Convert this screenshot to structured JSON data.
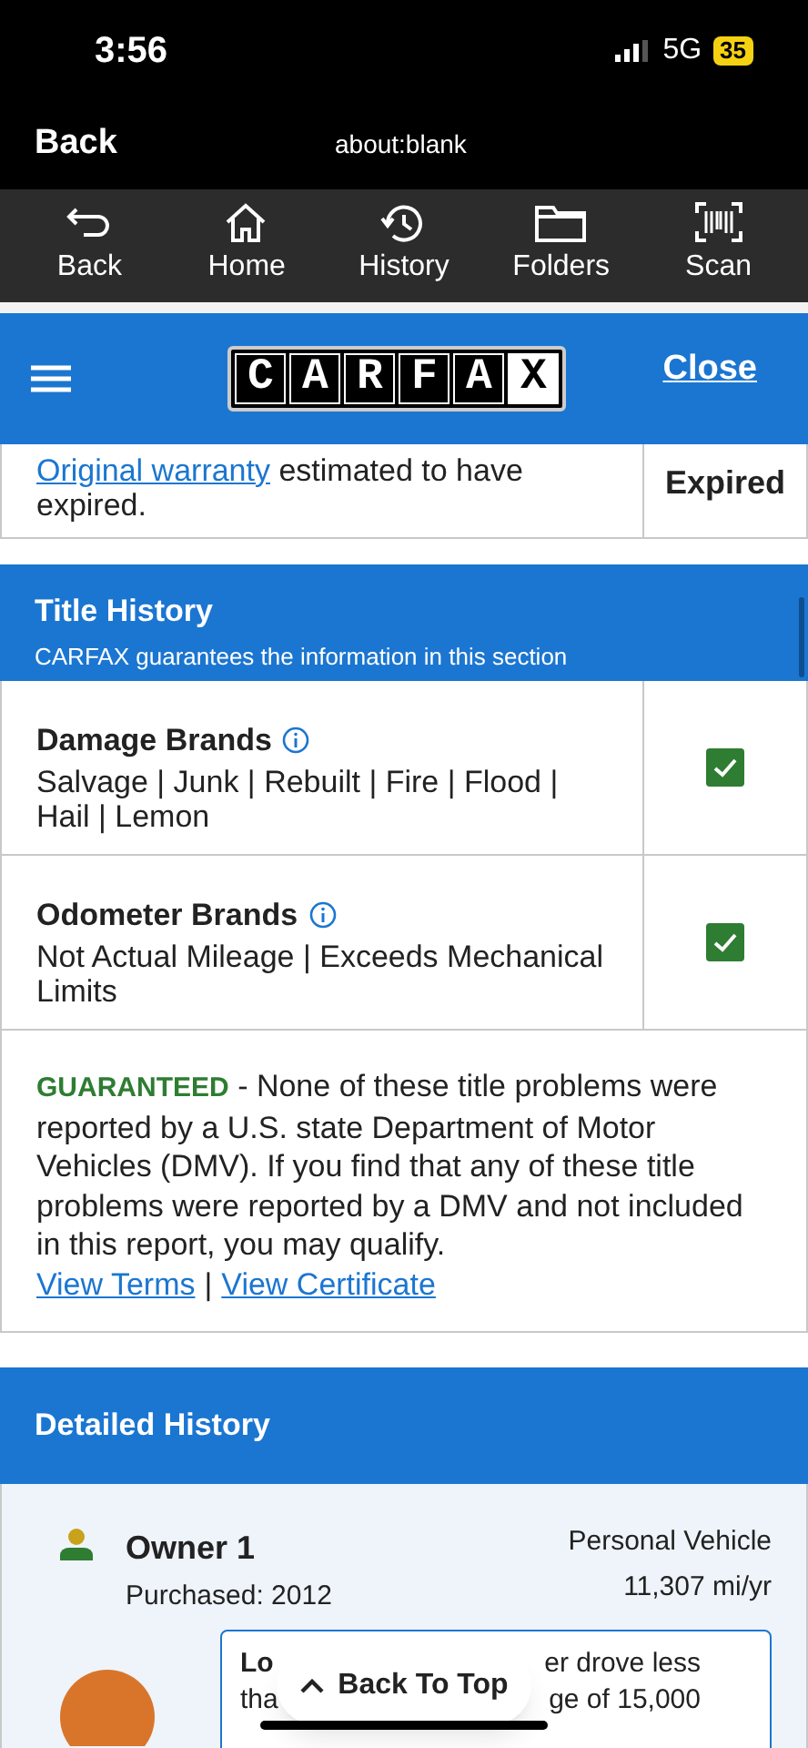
{
  "status_bar": {
    "time": "3:56",
    "network": "5G",
    "battery": "35"
  },
  "nav_bar": {
    "back": "Back",
    "url": "about:blank"
  },
  "toolbar": [
    {
      "kind": "back",
      "label": "Back"
    },
    {
      "kind": "home",
      "label": "Home"
    },
    {
      "kind": "history",
      "label": "History"
    },
    {
      "kind": "folders",
      "label": "Folders"
    },
    {
      "kind": "scan",
      "label": "Scan"
    }
  ],
  "header": {
    "logo": "CARFAX",
    "close": "Close"
  },
  "warranty_row": {
    "link": "Original warranty",
    "text": "estimated to have expired.",
    "status": "Expired"
  },
  "title_history": {
    "title": "Title History",
    "subtitle": "CARFAX guarantees the information in this section",
    "rows": [
      {
        "title": "Damage Brands",
        "items": "Salvage | Junk | Rebuilt | Fire | Flood | Hail | Lemon",
        "checked": true
      },
      {
        "title": "Odometer Brands",
        "items": "Not Actual Mileage | Exceeds Mechanical Limits",
        "checked": true
      }
    ],
    "guarantee": {
      "label": "GUARANTEED",
      "text": "- None of these title problems were reported by a U.S. state Department of Motor Vehicles (DMV). If you find that any of these title problems were reported by a DMV and not included in this report, you may qualify.",
      "links": [
        "View Terms",
        "View Certificate"
      ],
      "separator": "|"
    }
  },
  "detailed_history": {
    "title": "Detailed History",
    "owner": {
      "name": "Owner 1",
      "purchased": "Purchased: 2012",
      "type": "Personal Vehicle",
      "mileage": "11,307 mi/yr",
      "note_lines": [
        [
          "Lo",
          "er drove less"
        ],
        [
          "tha",
          "ge of 15,000"
        ]
      ]
    }
  },
  "back_to_top": "Back To Top"
}
